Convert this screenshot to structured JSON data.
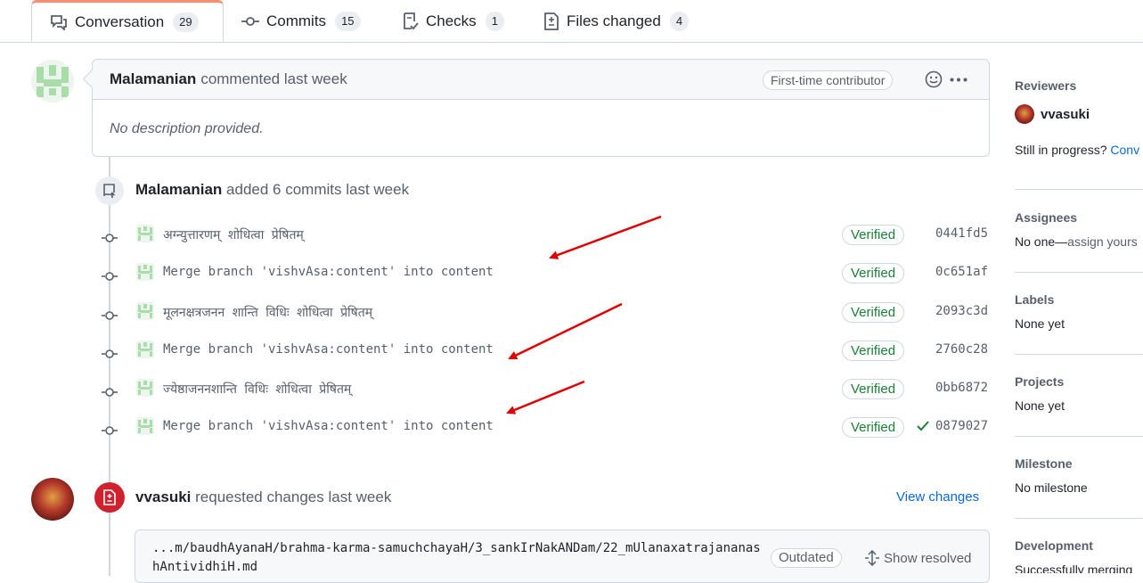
{
  "tabs": [
    {
      "label": "Conversation",
      "count": "29",
      "icon": "comment-discussion-icon"
    },
    {
      "label": "Commits",
      "count": "15",
      "icon": "git-commit-icon"
    },
    {
      "label": "Checks",
      "count": "1",
      "icon": "checklist-icon"
    },
    {
      "label": "Files changed",
      "count": "4",
      "icon": "file-diff-icon"
    }
  ],
  "comment": {
    "author": "Malamanian",
    "action": "commented last week",
    "badge": "First-time contributor",
    "body": "No description provided."
  },
  "commits_event": {
    "author": "Malamanian",
    "action": "added 6 commits last week"
  },
  "commits": [
    {
      "message": "अग्न्युत्तारणम् शोधित्वा प्रेषितम्",
      "verified": "Verified",
      "sha": "0441fd5",
      "check": false
    },
    {
      "message": "Merge branch 'vishvAsa:content' into content",
      "verified": "Verified",
      "sha": "0c651af",
      "check": false
    },
    {
      "message": "मूलनक्षत्रजनन शान्ति विधिः शोधित्वा प्रेषितम्",
      "verified": "Verified",
      "sha": "2093c3d",
      "check": false
    },
    {
      "message": "Merge branch 'vishvAsa:content' into content",
      "verified": "Verified",
      "sha": "2760c28",
      "check": false
    },
    {
      "message": "ज्येष्ठाजननशान्ति विधिः शोधित्वा प्रेषितम्",
      "verified": "Verified",
      "sha": "0bb6872",
      "check": false
    },
    {
      "message": "Merge branch 'vishvAsa:content' into content",
      "verified": "Verified",
      "sha": "0879027",
      "check": true
    }
  ],
  "review": {
    "author": "vvasuki",
    "action": "requested changes last week",
    "view_changes": "View changes",
    "file_path": "...m/baudhAyanaH/brahma-karma-samuchchayaH/3_sankIrNakANDam/22_mUlanaxatrajananashAntividhiH.md",
    "outdated": "Outdated",
    "show_resolved": "Show resolved"
  },
  "sidebar": {
    "reviewers_title": "Reviewers",
    "reviewer": "vvasuki",
    "still_in_progress": "Still in progress?",
    "still_link": "Conv",
    "assignees_title": "Assignees",
    "assignees_value": "No one—",
    "assignees_link": "assign yours",
    "labels_title": "Labels",
    "labels_value": "None yet",
    "projects_title": "Projects",
    "projects_value": "None yet",
    "milestone_title": "Milestone",
    "milestone_value": "No milestone",
    "development_title": "Development",
    "development_value": "Successfully merging"
  },
  "colors": {
    "accent_tab": "#fd8c73",
    "verified": "#1a7f37",
    "link": "#0969da",
    "danger": "#cf222e",
    "annotation_arrow": "#e00000"
  }
}
